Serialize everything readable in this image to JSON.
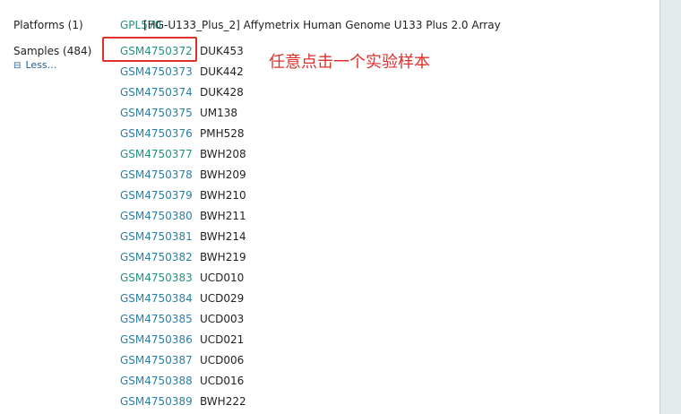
{
  "platforms": {
    "label": "Platforms (1)",
    "accession": "GPL570",
    "description": "[HG-U133_Plus_2] Affymetrix Human Genome U133 Plus 2.0 Array"
  },
  "samples": {
    "label": "Samples (484)",
    "less_icon": "collapse-icon",
    "less_label": "Less...",
    "rows": [
      {
        "accession": "GSM4750372",
        "name": "DUK453"
      },
      {
        "accession": "GSM4750373",
        "name": "DUK442"
      },
      {
        "accession": "GSM4750374",
        "name": "DUK428"
      },
      {
        "accession": "GSM4750375",
        "name": "UM138"
      },
      {
        "accession": "GSM4750376",
        "name": "PMH528"
      },
      {
        "accession": "GSM4750377",
        "name": "BWH208"
      },
      {
        "accession": "GSM4750378",
        "name": "BWH209"
      },
      {
        "accession": "GSM4750379",
        "name": "BWH210"
      },
      {
        "accession": "GSM4750380",
        "name": "BWH211"
      },
      {
        "accession": "GSM4750381",
        "name": "BWH214"
      },
      {
        "accession": "GSM4750382",
        "name": "BWH219"
      },
      {
        "accession": "GSM4750383",
        "name": "UCD010"
      },
      {
        "accession": "GSM4750384",
        "name": "UCD029"
      },
      {
        "accession": "GSM4750385",
        "name": "UCD003"
      },
      {
        "accession": "GSM4750386",
        "name": "UCD021"
      },
      {
        "accession": "GSM4750387",
        "name": "UCD006"
      },
      {
        "accession": "GSM4750388",
        "name": "UCD016"
      },
      {
        "accession": "GSM4750389",
        "name": "BWH222"
      }
    ]
  },
  "annotation": {
    "text": "任意点击一个实验样本",
    "color": "#e0302b"
  },
  "colors": {
    "link": "#2a7fa6",
    "visited_link": "#23927f",
    "panel": "#e4eaea"
  }
}
